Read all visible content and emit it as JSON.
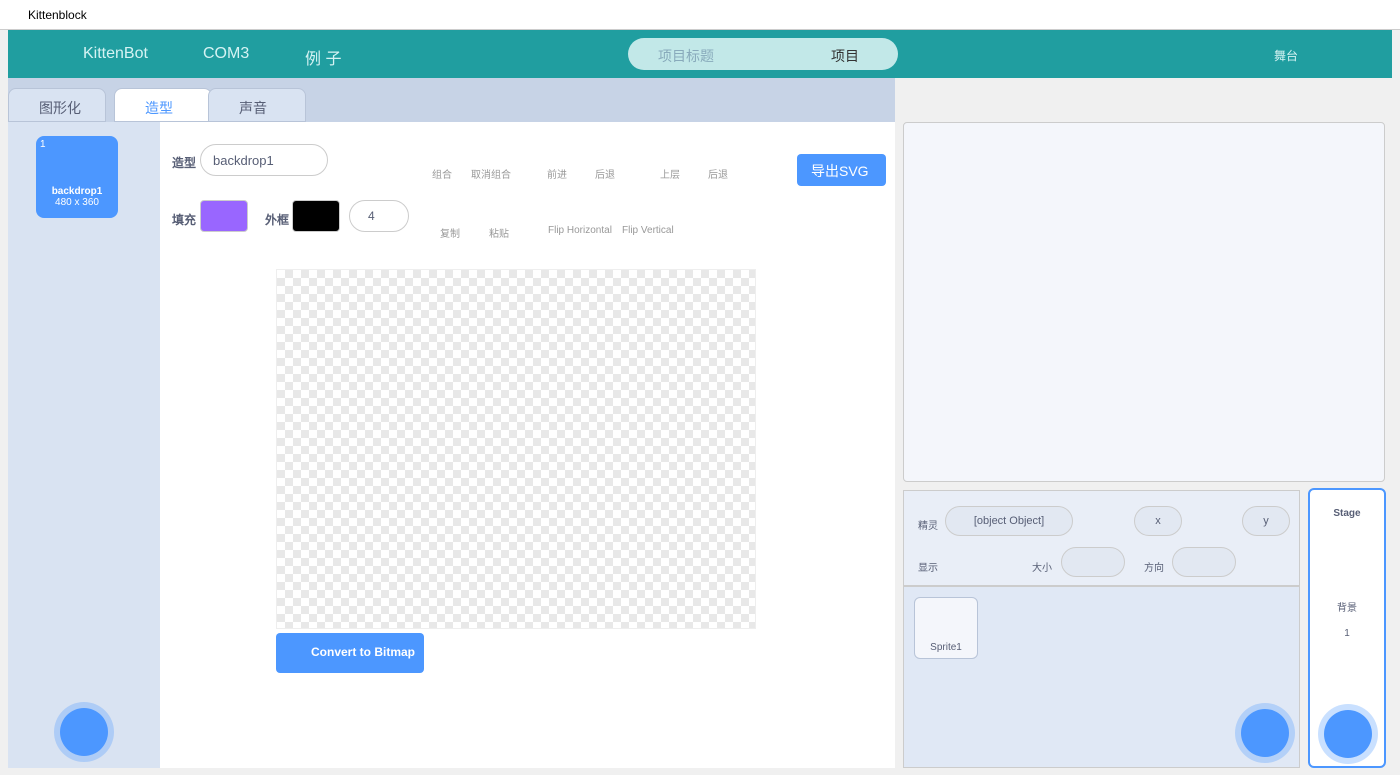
{
  "window": {
    "title": "Kittenblock"
  },
  "menu": {
    "kittenbot": "KittenBot",
    "port": "COM3",
    "examples": "例 子",
    "project_title_placeholder": "项目标题",
    "project": "项目",
    "stage_toggle": "舞台"
  },
  "tabs": [
    "图形化",
    "造型",
    "声音"
  ],
  "costume": {
    "index": "1",
    "name": "backdrop1",
    "size": "480 x 360"
  },
  "editor": {
    "costume_label": "造型",
    "costume_name": "backdrop1",
    "fill_label": "填充",
    "fill_color": "#9966ff",
    "outline_label": "外框",
    "outline_width": "4",
    "group": "组合",
    "ungroup": "取消组合",
    "forward": "前进",
    "backward": "后退",
    "front": "上层",
    "back": "后退",
    "copy": "复制",
    "paste": "粘贴",
    "flip_h": "Flip Horizontal",
    "flip_v": "Flip Vertical",
    "export": "导出SVG",
    "convert": "Convert to Bitmap"
  },
  "sprite": {
    "label": "精灵",
    "name": "[object Object]",
    "x": "x",
    "y": "y",
    "show": "显示",
    "size": "大小",
    "direction": "方向",
    "sprite1": "Sprite1"
  },
  "stage": {
    "title": "Stage",
    "backdrops": "背景",
    "count": "1"
  }
}
